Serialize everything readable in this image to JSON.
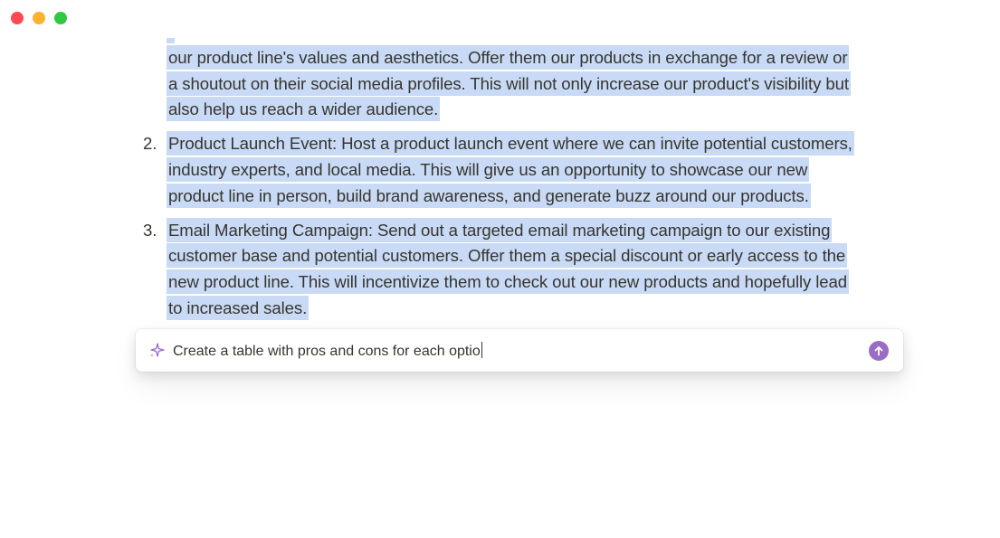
{
  "window": {
    "controls": [
      "close",
      "minimize",
      "maximize"
    ]
  },
  "document": {
    "items": [
      {
        "number": "",
        "lines": [
          "our product line's values and aesthetics. Offer them our products in exchange for a review or",
          "a shoutout on their social media profiles. This will not only increase our product's visibility but",
          "also help us reach a wider audience."
        ]
      },
      {
        "number": "2.",
        "lines": [
          "Product Launch Event: Host a product launch event where we can invite potential customers,",
          "industry experts, and local media. This will give us an opportunity to showcase our new",
          "product line in person, build brand awareness, and generate buzz around our products."
        ]
      },
      {
        "number": "3.",
        "lines": [
          "Email Marketing Campaign: Send out a targeted email marketing campaign to our existing",
          "customer base and potential customers. Offer them a special discount or early access to the",
          "new product line. This will incentivize them to check out our new products and hopefully lead",
          "to increased sales."
        ]
      }
    ]
  },
  "ai_prompt": {
    "icon": "sparkle-icon",
    "value": "Create a table with pros and cons for each optio",
    "submit_icon": "arrow-up-icon",
    "accent_color": "#9a6dc4"
  },
  "colors": {
    "selection": "#c8daf5",
    "text": "#37352f"
  }
}
